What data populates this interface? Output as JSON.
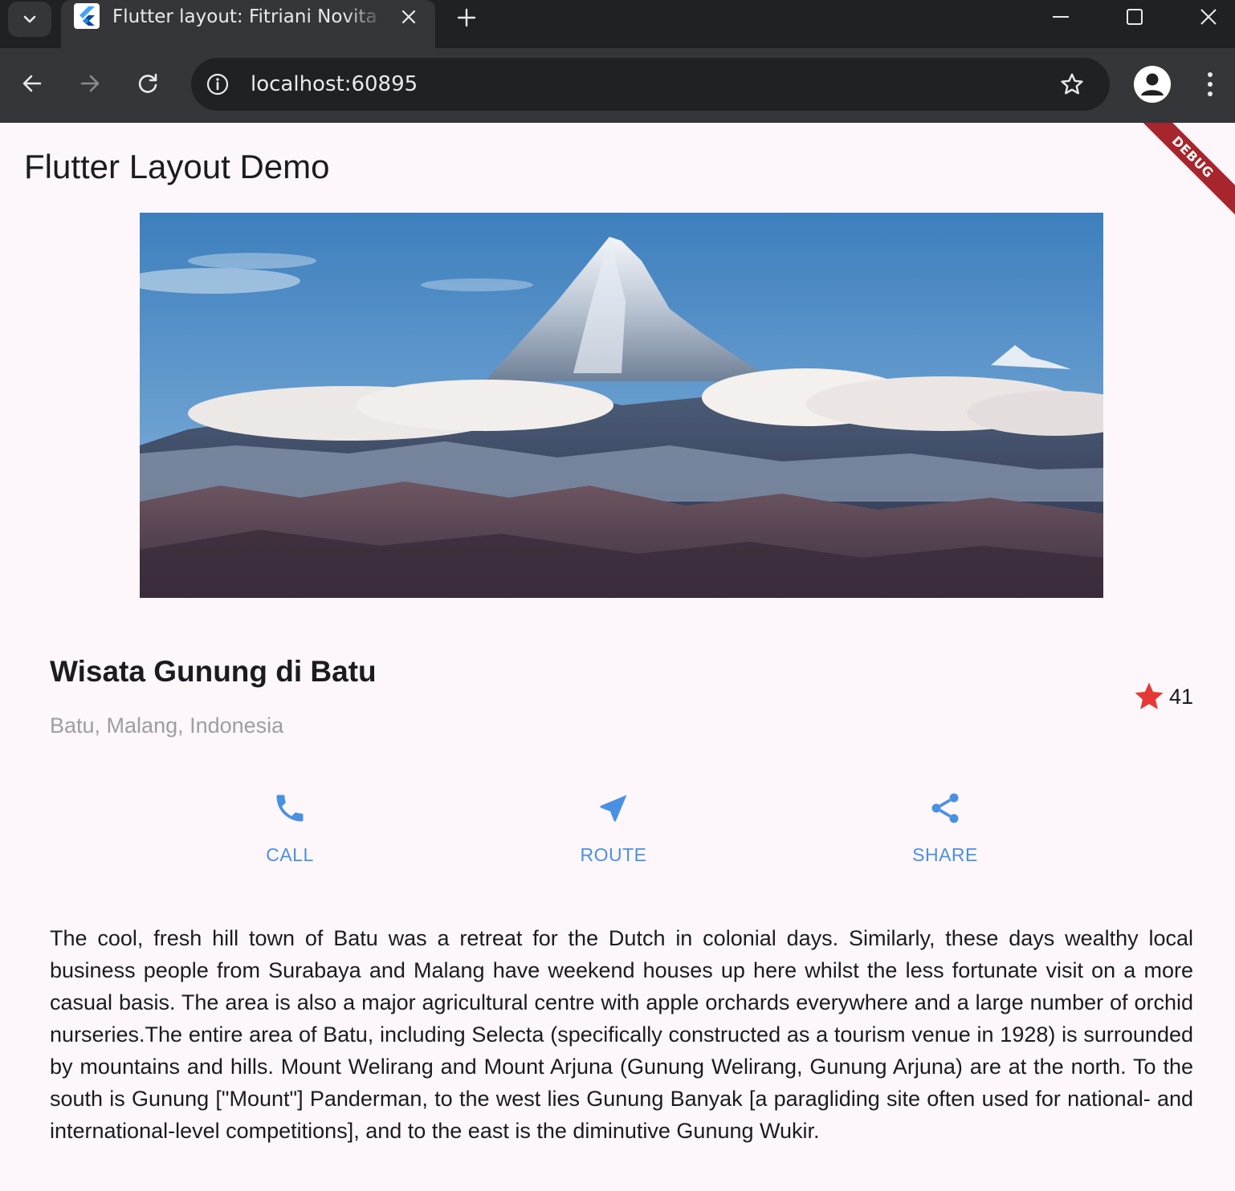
{
  "browser": {
    "tab_title": "Flutter layout: Fitriani Novita Ma",
    "url": "localhost:60895"
  },
  "app": {
    "debug_label": "DEBUG",
    "appbar_title": "Flutter Layout Demo",
    "place": {
      "name": "Wisata Gunung di Batu",
      "location": "Batu, Malang, Indonesia",
      "rating_count": "41"
    },
    "actions": [
      {
        "label": "CALL",
        "icon": "call-icon"
      },
      {
        "label": "ROUTE",
        "icon": "near-me-icon"
      },
      {
        "label": "SHARE",
        "icon": "share-icon"
      }
    ],
    "description": "The cool, fresh hill town of Batu was a retreat for the Dutch in colonial days. Similarly, these days wealthy local business people from Surabaya and Malang have weekend houses up here whilst the less fortunate visit on a more casual basis. The area is also a major agricultural centre with apple orchards everywhere and a large number of orchid nurseries.The entire area of Batu, including Selecta (specifically constructed as a tourism venue in 1928) is surrounded by mountains and hills. Mount Welirang and Mount Arjuna (Gunung Welirang, Gunung Arjuna) are at the north. To the south is Gunung [\"Mount\"] Panderman, to the west lies Gunung Banyak [a paragliding site often used for national- and international-level competitions], and to the east is the diminutive Gunung Wukir."
  },
  "colors": {
    "accent": "#4a90e2",
    "star": "#e53935",
    "background": "#fdf7fc"
  }
}
